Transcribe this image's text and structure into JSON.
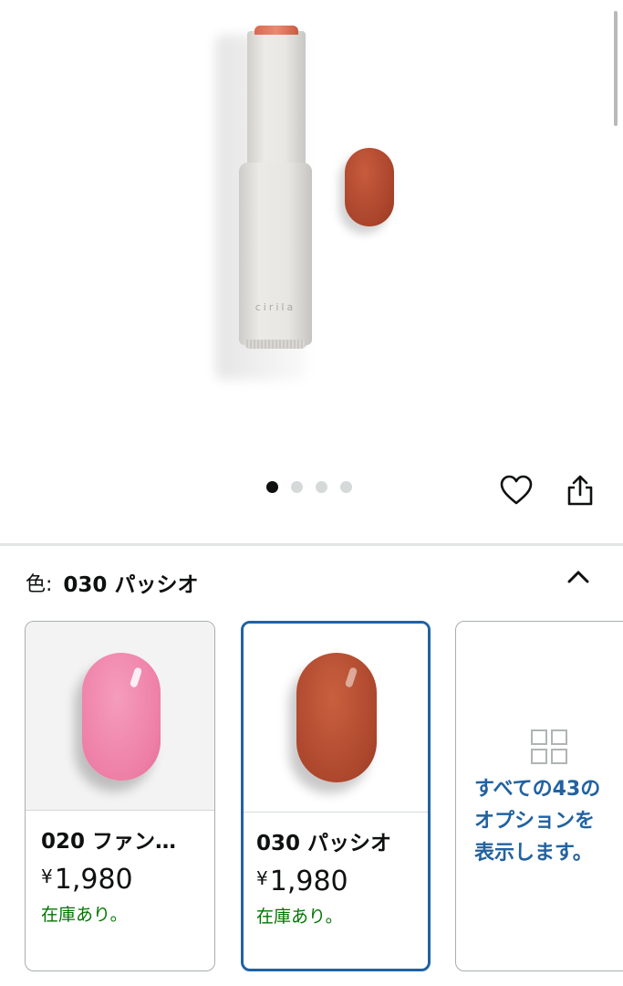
{
  "product": {
    "brand_on_tube": "cirila",
    "image_count": 4,
    "active_image_index": 0
  },
  "icons": {
    "wishlist": "heart-icon",
    "share": "share-icon",
    "collapse": "chevron-up-icon",
    "view_all": "grid-icon"
  },
  "color_selector": {
    "label": "色:",
    "selected_value": "030 パッシオ",
    "options": [
      {
        "name": "020 ファン…",
        "price_symbol": "¥",
        "price": "1,980",
        "stock": "在庫あり。",
        "swatch_color": "#ee7fa6",
        "selected": false
      },
      {
        "name": "030 パッシオ",
        "price_symbol": "¥",
        "price": "1,980",
        "stock": "在庫あり。",
        "swatch_color": "#ad472d",
        "selected": true
      }
    ],
    "view_all_text": "すべての43の\nオプションを\n表示します。"
  },
  "colors": {
    "selected_border": "#2162a1",
    "link": "#2162a1",
    "in_stock": "#007600",
    "swatch_product": "#a9442b"
  }
}
